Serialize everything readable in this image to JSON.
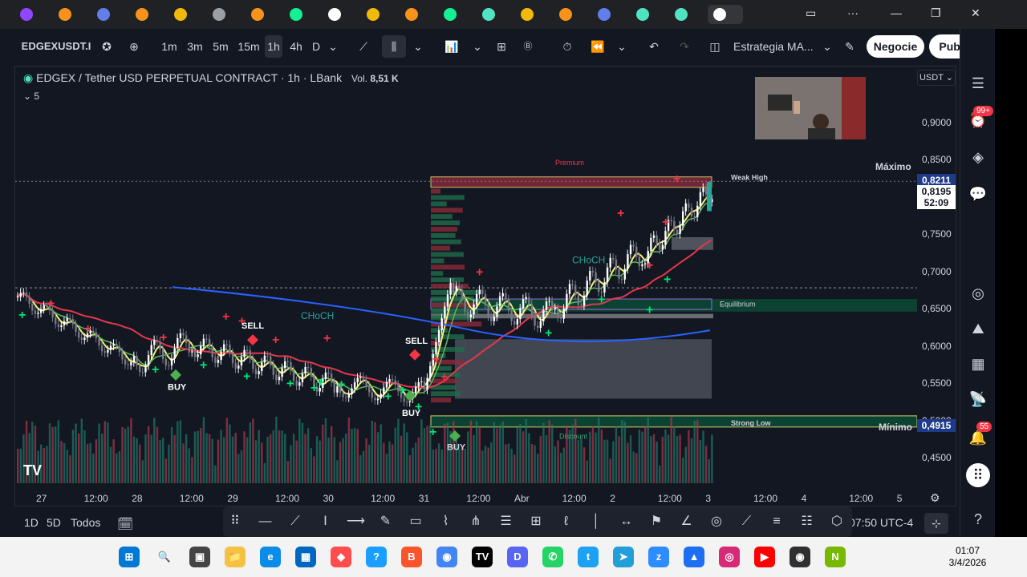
{
  "browser": {
    "tabs": [
      {
        "icon": "twitch-icon",
        "color": "#9146ff"
      },
      {
        "icon": "bitcoin-icon",
        "color": "#f7931a"
      },
      {
        "icon": "ethereum-icon",
        "color": "#627eea"
      },
      {
        "icon": "bitcoin-icon",
        "color": "#f7931a"
      },
      {
        "icon": "shield-icon",
        "color": "#f0b90b"
      },
      {
        "icon": "cloud-icon",
        "color": "#9aa0a6"
      },
      {
        "icon": "bitcoin-icon",
        "color": "#f7931a"
      },
      {
        "icon": "solana-icon",
        "color": "#14f195"
      },
      {
        "icon": "x-icon",
        "color": "#ffffff"
      },
      {
        "icon": "emoji-icon",
        "color": "#f0b90b"
      },
      {
        "icon": "bitcoin-icon",
        "color": "#f7931a"
      },
      {
        "icon": "solana-icon",
        "color": "#14f195"
      },
      {
        "icon": "hype-icon",
        "color": "#50e3c2"
      },
      {
        "icon": "emoji-icon",
        "color": "#f0b90b"
      },
      {
        "icon": "bitcoin-icon",
        "color": "#f7931a"
      },
      {
        "icon": "ethereum-icon",
        "color": "#627eea"
      },
      {
        "icon": "edgex-icon",
        "color": "#50e3c2"
      },
      {
        "icon": "edgex-icon",
        "color": "#50e3c2"
      },
      {
        "icon": "tradingview-icon",
        "color": "#ffffff"
      }
    ]
  },
  "toolbar": {
    "symbol": "EDGEXUSDT.I",
    "intervals": [
      "1m",
      "3m",
      "5m",
      "15m",
      "1h",
      "4h",
      "D"
    ],
    "active_interval": "1h",
    "indicator_template": "Estrategia MA...",
    "negocie_label": "Negocie",
    "publicar_label": "Publicar"
  },
  "chart": {
    "title": "EDGEX / Tether USD PERPETUAL CONTRACT · 1h · LBank",
    "vol_label": "Vol.",
    "vol_value": "8,51 K",
    "interval_count": "5",
    "currency": "USDT",
    "price_labels": [
      "0,9000",
      "0,8500",
      "0,7500",
      "0,7000",
      "0,6500",
      "0,6000",
      "0,5500",
      "0,5000",
      "0,4500"
    ],
    "max_label": "Máximo",
    "max_value": "0,8211",
    "min_label": "Mínimo",
    "min_value": "0,4915",
    "current_price": "0,8195",
    "countdown": "52:09",
    "annotations": {
      "premium": "Premium",
      "weak_high": "Weak High",
      "equilibrium": "Equilibrium",
      "strong_low": "Strong Low",
      "discount": "Discount",
      "choch1": "CHoCH",
      "choch2": "CHoCH",
      "sell1": "SELL",
      "sell2": "SELL",
      "buy1": "BUY",
      "buy2": "BUY",
      "buy3": "BUY"
    },
    "time_labels": [
      "27",
      "12:00",
      "28",
      "12:00",
      "29",
      "12:00",
      "30",
      "12:00",
      "31",
      "12:00",
      "Abr",
      "12:00",
      "2",
      "12:00",
      "3",
      "12:00",
      "4",
      "12:00",
      "5"
    ],
    "colors": {
      "bull": "#26a69a",
      "bear": "#ef5350",
      "ma_yellow": "#f5f07a",
      "ma_green": "#5bb85d",
      "ma_red": "#e5374b",
      "ma_blue": "#2962ff"
    }
  },
  "bottom": {
    "ranges": [
      "1D",
      "5D",
      "Todos"
    ],
    "time_display": "07:50 UTC-4"
  },
  "sidebar": {
    "notifications_badge": "99+",
    "alerts_badge": "55"
  },
  "taskbar": {
    "time": "01:07",
    "date": "3/4/2026"
  }
}
